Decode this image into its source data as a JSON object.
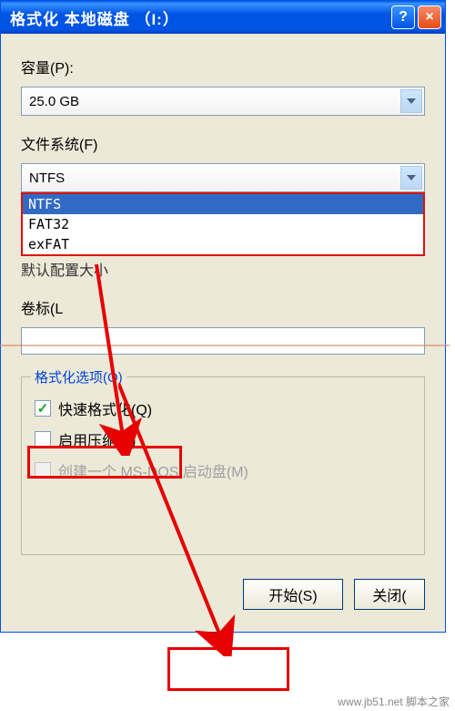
{
  "titlebar": {
    "title": "格式化 本地磁盘 （I:）",
    "help": "?",
    "close": "×"
  },
  "capacity": {
    "label": "容量(P):",
    "value": "25.0 GB"
  },
  "filesystem": {
    "label": "文件系统(F)",
    "value": "NTFS",
    "options": [
      "NTFS",
      "FAT32",
      "exFAT"
    ]
  },
  "alloc": {
    "partial": "默认配置大小"
  },
  "volume": {
    "label": "卷标(L"
  },
  "options": {
    "legend": "格式化选项(O)",
    "quick": "快速格式化(Q)",
    "compress": "启用压缩(E)",
    "msdos": "创建一个 MS-DOS 启动盘(M)"
  },
  "buttons": {
    "start": "开始(S)",
    "close": "关闭("
  },
  "watermark": "www.jb51.net 脚本之家"
}
